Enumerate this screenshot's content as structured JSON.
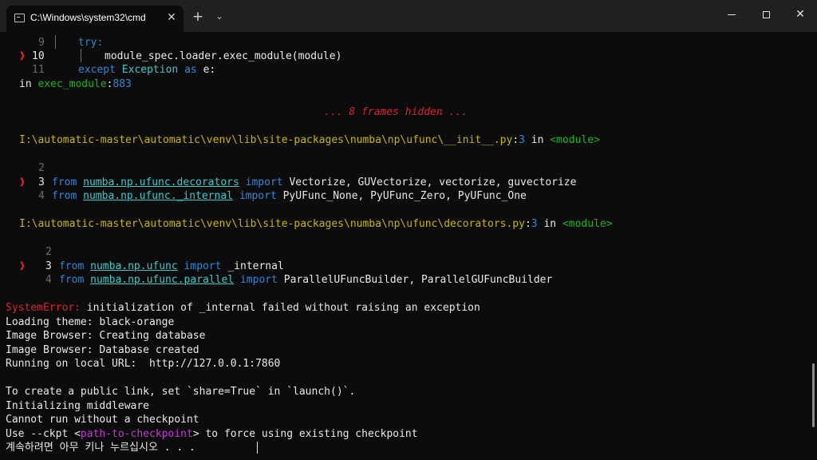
{
  "window": {
    "tab_title": "C:\\Windows\\system32\\cmd",
    "tab_close_glyph": "✕",
    "new_tab_glyph": "+",
    "dropdown_glyph": "⌄",
    "close_glyph": "✕"
  },
  "colors": {
    "background": "#0c0c0c",
    "text": "#cccccc",
    "error_red": "#d6232e",
    "path_yellow": "#c8b400",
    "module_green": "#21b021",
    "keyword_blue": "#2f86d8",
    "link_teal": "#3ec9c9"
  },
  "traceback": {
    "block1": {
      "l9_num": "9",
      "l9_code": "try:",
      "l10_marker": "❱",
      "l10_num": "10",
      "l10_code": "module_spec.loader.exec_module(module)",
      "l11_num": "11",
      "l11_kw": "except",
      "l11_exc": "Exception",
      "l11_as": "as",
      "l11_rest": "e:",
      "in_word": "in",
      "func": "exec_module",
      "colon": ":",
      "lineno": "883"
    },
    "hidden_frames": "... 8 frames hidden ...",
    "frame1": {
      "path": "I:\\automatic-master\\automatic\\venv\\lib\\site-packages\\numba\\np\\ufunc\\__init__.py",
      "sep": ":",
      "lineno": "3",
      "in_word": "in",
      "module": "<module>",
      "l2_num": "2",
      "l3_marker": "❱",
      "l3_num": "3",
      "l3_from": "from",
      "l3_mod": "numba.np.ufunc.decorators",
      "l3_import": "import",
      "l3_names": "Vectorize, GUVectorize, vectorize, guvectorize",
      "l4_num": "4",
      "l4_from": "from",
      "l4_mod": "numba.np.ufunc._internal",
      "l4_import": "import",
      "l4_names": "PyUFunc_None, PyUFunc_Zero, PyUFunc_One"
    },
    "frame2": {
      "path": "I:\\automatic-master\\automatic\\venv\\lib\\site-packages\\numba\\np\\ufunc\\decorators.py",
      "sep": ":",
      "lineno": "3",
      "in_word": "in",
      "module": "<module>",
      "l2_num": "2",
      "l3_marker": "❱",
      "l3_num": "3",
      "l3_from": "from",
      "l3_mod": "numba.np.ufunc",
      "l3_import": "import",
      "l3_names": "_internal",
      "l4_num": "4",
      "l4_from": "from",
      "l4_mod": "numba.np.ufunc.parallel",
      "l4_import": "import",
      "l4_names": "ParallelUFuncBuilder, ParallelGUFuncBuilder"
    }
  },
  "output": {
    "error_label": "SystemError:",
    "error_msg": "initialization of _internal failed without raising an exception",
    "theme": "Loading theme: black-orange",
    "browser1": "Image Browser: Creating database",
    "browser2": "Image Browser: Database created",
    "running": "Running on local URL:  http://127.0.0.1:7860",
    "public_link": "To create a public link, set `share=True` in `launch()`.",
    "middleware": "Initializing middleware",
    "no_checkpoint": "Cannot run without a checkpoint",
    "use_prefix": "Use --ckpt <",
    "use_arg": "path-to-checkpoint",
    "use_suffix": "> to force using existing checkpoint",
    "pause": "계속하려면 아무 키나 누르십시오 . . ."
  }
}
